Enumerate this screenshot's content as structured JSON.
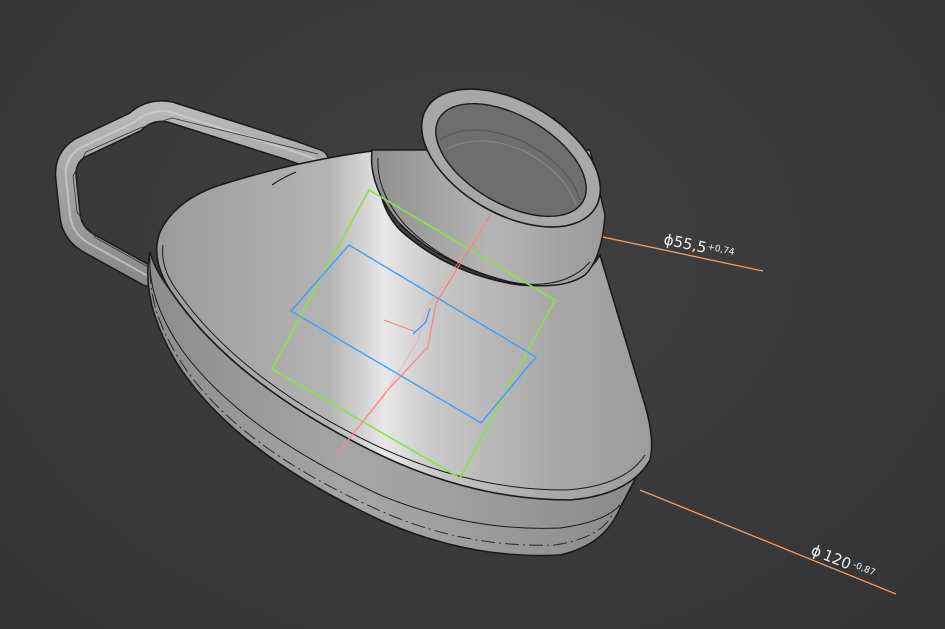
{
  "viewport": {
    "background_color": "#3a3a3a",
    "model_color": "#a9a9a9",
    "edge_color": "#1a1a1a"
  },
  "dimensions": [
    {
      "symbol": "ϕ",
      "value": "55,5",
      "tolerance": "+0,74",
      "line_color": "#f0a060"
    },
    {
      "symbol": "ϕ",
      "value": "120",
      "tolerance": "-0,87",
      "line_color": "#f0a060"
    }
  ],
  "sketch": {
    "plane_color": "#8ee04a",
    "rectangle_color": "#3aa0ff",
    "axis_color": "#ff7a7a"
  }
}
